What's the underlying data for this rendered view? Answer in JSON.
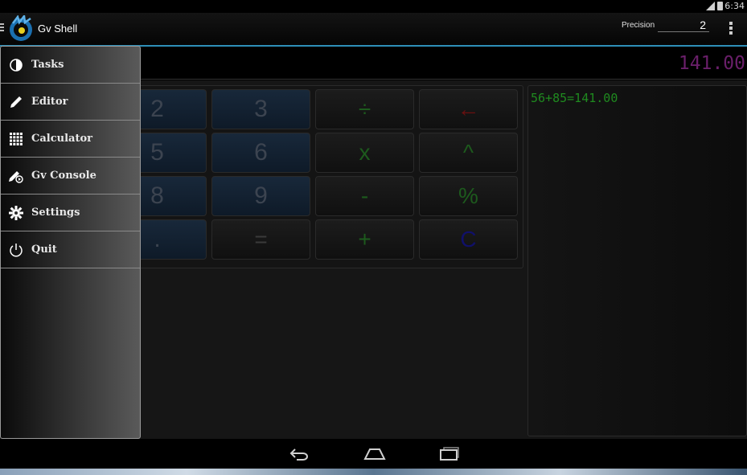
{
  "status": {
    "time": "6:34"
  },
  "app": {
    "title": "Gv Shell",
    "precision_label": "Precision",
    "precision_value": "2"
  },
  "result": {
    "display": "141.00"
  },
  "console": {
    "lines": [
      "56+85=141.00"
    ]
  },
  "drawer": {
    "items": [
      {
        "label": "Tasks",
        "icon": "pie-chart-icon"
      },
      {
        "label": "Editor",
        "icon": "pencil-icon"
      },
      {
        "label": "Calculator",
        "icon": "grid-icon"
      },
      {
        "label": "Gv Console",
        "icon": "console-pen-icon"
      },
      {
        "label": "Settings",
        "icon": "gear-icon"
      },
      {
        "label": "Quit",
        "icon": "power-icon"
      }
    ]
  },
  "keypad": {
    "keys": [
      {
        "label": "2",
        "kind": "num"
      },
      {
        "label": "3",
        "kind": "num"
      },
      {
        "label": "÷",
        "kind": "op",
        "color": "#1d5a1d"
      },
      {
        "label": "←",
        "kind": "op",
        "color": "#6a1010"
      },
      {
        "label": "5",
        "kind": "num"
      },
      {
        "label": "6",
        "kind": "num"
      },
      {
        "label": "x",
        "kind": "op",
        "color": "#1d5a1d"
      },
      {
        "label": "^",
        "kind": "op",
        "color": "#1d5a1d"
      },
      {
        "label": "8",
        "kind": "num"
      },
      {
        "label": "9",
        "kind": "num"
      },
      {
        "label": "-",
        "kind": "op",
        "color": "#1d5a1d"
      },
      {
        "label": "%",
        "kind": "op",
        "color": "#1d5a1d"
      },
      {
        "label": ".",
        "kind": "num"
      },
      {
        "label": "=",
        "kind": "op",
        "color": "#3a3a3a"
      },
      {
        "label": "+",
        "kind": "op",
        "color": "#1d5a1d"
      },
      {
        "label": "C",
        "kind": "op",
        "color": "#10106a"
      }
    ]
  }
}
